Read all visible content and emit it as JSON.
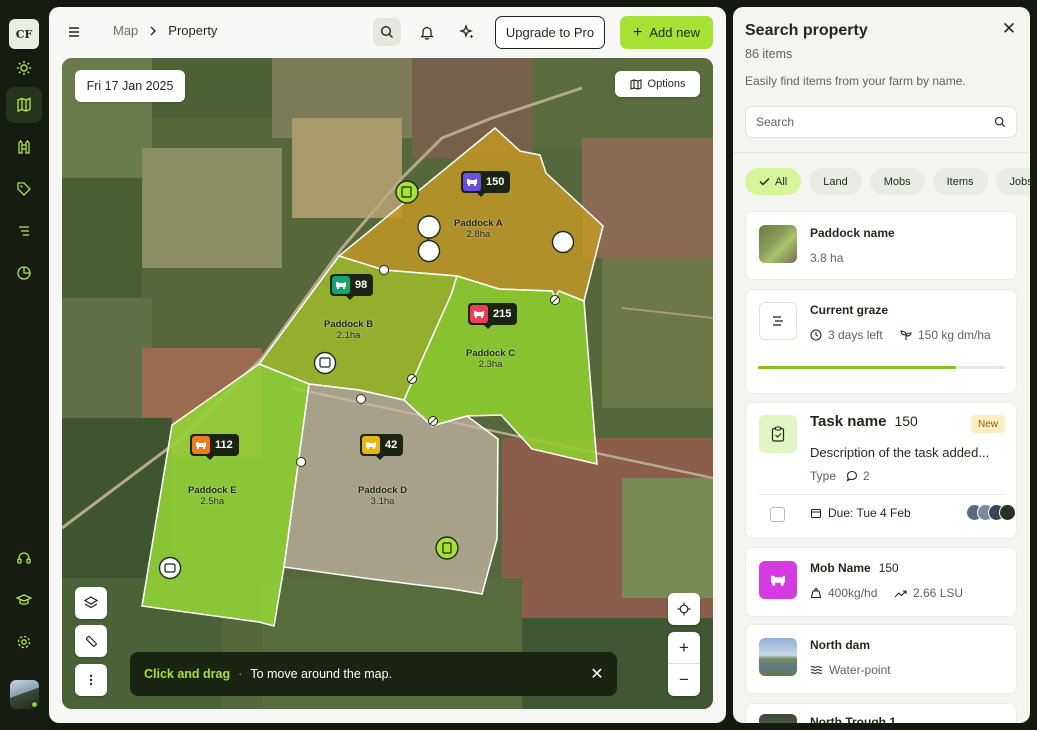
{
  "app": {
    "logo_text": "CF"
  },
  "rail": {
    "items": [
      "sun-icon",
      "map-icon",
      "fence-icon",
      "tag-icon",
      "list-icon",
      "pie-chart-icon",
      "headset-icon",
      "graduation-icon",
      "settings-icon"
    ]
  },
  "topbar": {
    "breadcrumb_root": "Map",
    "breadcrumb_current": "Property",
    "upgrade_label": "Upgrade to Pro",
    "add_new_label": "Add new"
  },
  "map": {
    "date": "Fri 17 Jan 2025",
    "options_label": "Options",
    "paddocks": [
      {
        "name": "Paddock A",
        "area": "2.8ha"
      },
      {
        "name": "Paddock B",
        "area": "2.1ha"
      },
      {
        "name": "Paddock C",
        "area": "2.3ha"
      },
      {
        "name": "Paddock D",
        "area": "3.1ha"
      },
      {
        "name": "Paddock E",
        "area": "2.5ha"
      }
    ],
    "mobs": [
      {
        "count": "150",
        "color": "#6b4fd8"
      },
      {
        "count": "98",
        "color": "#1aa36a"
      },
      {
        "count": "215",
        "color": "#e8415a"
      },
      {
        "count": "112",
        "color": "#f07a1e"
      },
      {
        "count": "42",
        "color": "#e8b70e"
      }
    ],
    "zoom_in": "+",
    "zoom_out": "−",
    "toast": {
      "highlight": "Click and drag",
      "separator": "·",
      "message": "To move around the map."
    }
  },
  "panel": {
    "title": "Search property",
    "count": "86 items",
    "description": "Easily find items from your farm by name.",
    "search_placeholder": "Search",
    "filters": [
      "All",
      "Land",
      "Mobs",
      "Items",
      "Jobs"
    ],
    "paddock_card": {
      "title": "Paddock name",
      "area": "3.8 ha"
    },
    "graze_card": {
      "title": "Current graze",
      "days": "3 days left",
      "feed": "150 kg dm/ha",
      "progress": 0.8
    },
    "task_card": {
      "title": "Task name",
      "count": "150",
      "badge": "New",
      "description": "Description of the task added...",
      "type_label": "Type",
      "comments": "2",
      "due": "Due: Tue 4 Feb"
    },
    "mob_card": {
      "title": "Mob Name",
      "count": "150",
      "weight": "400kg/hd",
      "lsu": "2.66 LSU"
    },
    "dam_card": {
      "title": "North dam",
      "type": "Water-point"
    },
    "trough_card": {
      "title": "North Trough 1"
    }
  }
}
